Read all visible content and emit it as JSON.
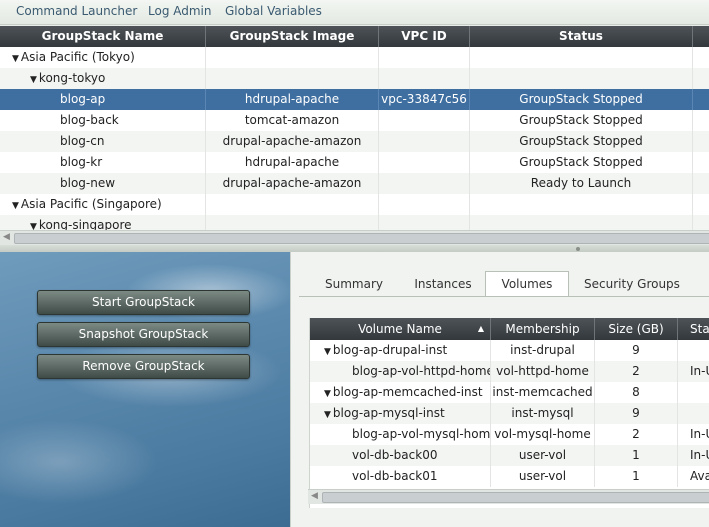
{
  "menu": {
    "items": [
      "Command Launcher",
      "Log Admin",
      "Global Variables"
    ]
  },
  "groupstacks": {
    "columns": [
      "GroupStack Name",
      "GroupStack Image",
      "VPC ID",
      "Status"
    ],
    "rows": [
      {
        "name": "Asia Pacific (Tokyo)",
        "image": "",
        "vpc": "",
        "status": ""
      },
      {
        "name": "kong-tokyo",
        "image": "",
        "vpc": "",
        "status": ""
      },
      {
        "name": "blog-ap",
        "image": "hdrupal-apache",
        "vpc": "vpc-33847c56",
        "status": "GroupStack Stopped"
      },
      {
        "name": "blog-back",
        "image": "tomcat-amazon",
        "vpc": "",
        "status": "GroupStack Stopped"
      },
      {
        "name": "blog-cn",
        "image": "drupal-apache-amazon",
        "vpc": "",
        "status": "GroupStack Stopped"
      },
      {
        "name": "blog-kr",
        "image": "hdrupal-apache",
        "vpc": "",
        "status": "GroupStack Stopped"
      },
      {
        "name": "blog-new",
        "image": "drupal-apache-amazon",
        "vpc": "",
        "status": "Ready to Launch"
      },
      {
        "name": "Asia Pacific (Singapore)",
        "image": "",
        "vpc": "",
        "status": ""
      },
      {
        "name": "kong-singapore",
        "image": "",
        "vpc": "",
        "status": ""
      }
    ]
  },
  "actions": {
    "start": "Start GroupStack",
    "snapshot": "Snapshot GroupStack",
    "remove": "Remove GroupStack"
  },
  "tabs": [
    "Summary",
    "Instances",
    "Volumes",
    "Security Groups"
  ],
  "volumes": {
    "columns": [
      "Volume Name",
      "Membership",
      "Size (GB)",
      "Stat"
    ],
    "rows": [
      {
        "name": "blog-ap-drupal-inst",
        "membership": "inst-drupal",
        "size": "9",
        "status": ""
      },
      {
        "name": "blog-ap-vol-httpd-home",
        "membership": "vol-httpd-home",
        "size": "2",
        "status": "In-U"
      },
      {
        "name": "blog-ap-memcached-inst",
        "membership": "inst-memcached",
        "size": "8",
        "status": ""
      },
      {
        "name": "blog-ap-mysql-inst",
        "membership": "inst-mysql",
        "size": "9",
        "status": ""
      },
      {
        "name": "blog-ap-vol-mysql-home",
        "membership": "vol-mysql-home",
        "size": "2",
        "status": "In-U"
      },
      {
        "name": "vol-db-back00",
        "membership": "user-vol",
        "size": "1",
        "status": "In-U"
      },
      {
        "name": "vol-db-back01",
        "membership": "user-vol",
        "size": "1",
        "status": "Avail"
      }
    ]
  },
  "colors": {
    "selected_row": "#3f6fa0",
    "header": "#33383c",
    "menu_link": "#3a5a70"
  }
}
